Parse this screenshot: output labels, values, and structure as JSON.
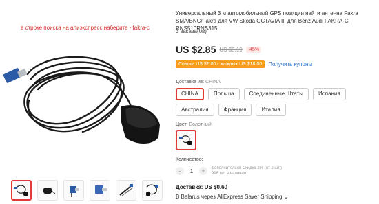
{
  "gallery": {
    "promo_note": "в строке  поиска на алиэкспресс наберите - fakra-c",
    "thumbnails": [
      "gps-antenna",
      "gps-antenna-small",
      "fakra-connector",
      "fakra-connector-blue",
      "cable-coil",
      "antenna-kit"
    ]
  },
  "product": {
    "title": "Универсальный 3 м автомобильный GPS позиции найти антенна Fakra SMA/BNC/Fakra для VW Skoda OCTAVIA III для Benz Audi FAKRA-C RNS510RNS315",
    "orders": "3 заказа(ов)",
    "price": "US $2.85",
    "old_price": "US $5.19",
    "discount": "-45%",
    "coupon": "Скидка US $1.00 с каждых US $18.00",
    "coupon_link": "Получить купоны"
  },
  "shipping_from": {
    "label": "Доставка из: ",
    "value": "CHINA",
    "options": [
      "CHINA",
      "Польша",
      "Соединенные Штаты",
      "Испания",
      "Австралия",
      "Франция",
      "Италия"
    ],
    "selected": "CHINA"
  },
  "color": {
    "label": "Цвет: ",
    "value": "Болотный"
  },
  "quantity": {
    "label": "Количество:",
    "minus": "-",
    "value": "1",
    "plus": "+",
    "info_line1": "Дополнительно Скидка 2% (от 2 шт.)",
    "info_line2": "998 шт. в наличии"
  },
  "delivery": {
    "cost": "Доставка: US $0.60",
    "route": "В Belarus через AliExpress Saver Shipping ⌄"
  },
  "colors": {
    "accent": "#e03a3a",
    "coupon_bg": "#f59e1b",
    "link": "#2673c4"
  }
}
